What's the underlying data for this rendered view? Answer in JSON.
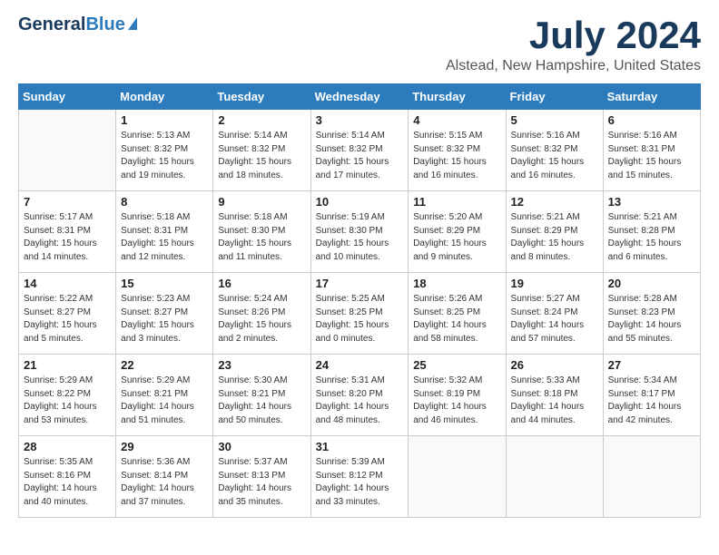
{
  "header": {
    "logo_general": "General",
    "logo_blue": "Blue",
    "month_year": "July 2024",
    "location": "Alstead, New Hampshire, United States"
  },
  "calendar": {
    "days_of_week": [
      "Sunday",
      "Monday",
      "Tuesday",
      "Wednesday",
      "Thursday",
      "Friday",
      "Saturday"
    ],
    "weeks": [
      [
        {
          "day": "",
          "info": ""
        },
        {
          "day": "1",
          "info": "Sunrise: 5:13 AM\nSunset: 8:32 PM\nDaylight: 15 hours\nand 19 minutes."
        },
        {
          "day": "2",
          "info": "Sunrise: 5:14 AM\nSunset: 8:32 PM\nDaylight: 15 hours\nand 18 minutes."
        },
        {
          "day": "3",
          "info": "Sunrise: 5:14 AM\nSunset: 8:32 PM\nDaylight: 15 hours\nand 17 minutes."
        },
        {
          "day": "4",
          "info": "Sunrise: 5:15 AM\nSunset: 8:32 PM\nDaylight: 15 hours\nand 16 minutes."
        },
        {
          "day": "5",
          "info": "Sunrise: 5:16 AM\nSunset: 8:32 PM\nDaylight: 15 hours\nand 16 minutes."
        },
        {
          "day": "6",
          "info": "Sunrise: 5:16 AM\nSunset: 8:31 PM\nDaylight: 15 hours\nand 15 minutes."
        }
      ],
      [
        {
          "day": "7",
          "info": "Sunrise: 5:17 AM\nSunset: 8:31 PM\nDaylight: 15 hours\nand 14 minutes."
        },
        {
          "day": "8",
          "info": "Sunrise: 5:18 AM\nSunset: 8:31 PM\nDaylight: 15 hours\nand 12 minutes."
        },
        {
          "day": "9",
          "info": "Sunrise: 5:18 AM\nSunset: 8:30 PM\nDaylight: 15 hours\nand 11 minutes."
        },
        {
          "day": "10",
          "info": "Sunrise: 5:19 AM\nSunset: 8:30 PM\nDaylight: 15 hours\nand 10 minutes."
        },
        {
          "day": "11",
          "info": "Sunrise: 5:20 AM\nSunset: 8:29 PM\nDaylight: 15 hours\nand 9 minutes."
        },
        {
          "day": "12",
          "info": "Sunrise: 5:21 AM\nSunset: 8:29 PM\nDaylight: 15 hours\nand 8 minutes."
        },
        {
          "day": "13",
          "info": "Sunrise: 5:21 AM\nSunset: 8:28 PM\nDaylight: 15 hours\nand 6 minutes."
        }
      ],
      [
        {
          "day": "14",
          "info": "Sunrise: 5:22 AM\nSunset: 8:27 PM\nDaylight: 15 hours\nand 5 minutes."
        },
        {
          "day": "15",
          "info": "Sunrise: 5:23 AM\nSunset: 8:27 PM\nDaylight: 15 hours\nand 3 minutes."
        },
        {
          "day": "16",
          "info": "Sunrise: 5:24 AM\nSunset: 8:26 PM\nDaylight: 15 hours\nand 2 minutes."
        },
        {
          "day": "17",
          "info": "Sunrise: 5:25 AM\nSunset: 8:25 PM\nDaylight: 15 hours\nand 0 minutes."
        },
        {
          "day": "18",
          "info": "Sunrise: 5:26 AM\nSunset: 8:25 PM\nDaylight: 14 hours\nand 58 minutes."
        },
        {
          "day": "19",
          "info": "Sunrise: 5:27 AM\nSunset: 8:24 PM\nDaylight: 14 hours\nand 57 minutes."
        },
        {
          "day": "20",
          "info": "Sunrise: 5:28 AM\nSunset: 8:23 PM\nDaylight: 14 hours\nand 55 minutes."
        }
      ],
      [
        {
          "day": "21",
          "info": "Sunrise: 5:29 AM\nSunset: 8:22 PM\nDaylight: 14 hours\nand 53 minutes."
        },
        {
          "day": "22",
          "info": "Sunrise: 5:29 AM\nSunset: 8:21 PM\nDaylight: 14 hours\nand 51 minutes."
        },
        {
          "day": "23",
          "info": "Sunrise: 5:30 AM\nSunset: 8:21 PM\nDaylight: 14 hours\nand 50 minutes."
        },
        {
          "day": "24",
          "info": "Sunrise: 5:31 AM\nSunset: 8:20 PM\nDaylight: 14 hours\nand 48 minutes."
        },
        {
          "day": "25",
          "info": "Sunrise: 5:32 AM\nSunset: 8:19 PM\nDaylight: 14 hours\nand 46 minutes."
        },
        {
          "day": "26",
          "info": "Sunrise: 5:33 AM\nSunset: 8:18 PM\nDaylight: 14 hours\nand 44 minutes."
        },
        {
          "day": "27",
          "info": "Sunrise: 5:34 AM\nSunset: 8:17 PM\nDaylight: 14 hours\nand 42 minutes."
        }
      ],
      [
        {
          "day": "28",
          "info": "Sunrise: 5:35 AM\nSunset: 8:16 PM\nDaylight: 14 hours\nand 40 minutes."
        },
        {
          "day": "29",
          "info": "Sunrise: 5:36 AM\nSunset: 8:14 PM\nDaylight: 14 hours\nand 37 minutes."
        },
        {
          "day": "30",
          "info": "Sunrise: 5:37 AM\nSunset: 8:13 PM\nDaylight: 14 hours\nand 35 minutes."
        },
        {
          "day": "31",
          "info": "Sunrise: 5:39 AM\nSunset: 8:12 PM\nDaylight: 14 hours\nand 33 minutes."
        },
        {
          "day": "",
          "info": ""
        },
        {
          "day": "",
          "info": ""
        },
        {
          "day": "",
          "info": ""
        }
      ]
    ]
  }
}
